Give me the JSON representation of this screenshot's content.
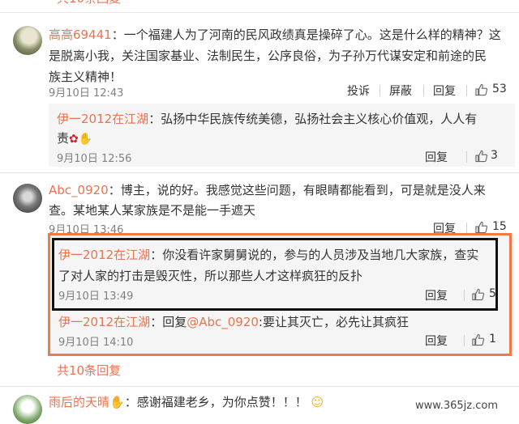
{
  "more_top": "共10条回复",
  "c1": {
    "user": "高高69441",
    "text": "：一个福建人为了河南的民风政绩真是操碎了心。这是什么样的精神？这是脱离小我，关注国家基业、法制民生，公序良俗，为子孙万代谋安定和前途的民族主义精神！",
    "line1": "：一个福建人为了河南的民风政绩真是操碎了心。这是什么样的精神？这",
    "line2": "是脱离小我，关注国家基业、法制民生，公序良俗，为子孙万代谋安定和前途的民",
    "line3": "族主义精神！",
    "time": "9月10日 12:43",
    "report": "投诉",
    "block": "屏蔽",
    "reply": "回复",
    "likes": "53"
  },
  "c1r1": {
    "user": "伊一2012在江湖",
    "line1": "：弘扬中华民族传统美德，弘扬社会主义核心价值观，人人有",
    "line2": "责",
    "time": "9月10日 12:56",
    "reply": "回复",
    "likes": "3"
  },
  "c2": {
    "user": "Abc_0920",
    "line1": "：博主，说的好。我感觉这些问题，有眼睛都能看到，可是就是没人来",
    "line2": "查。某地某人某家族是不是能一手遮天",
    "time": "9月10日 13:46",
    "reply": "回复",
    "likes": "15"
  },
  "c2r1": {
    "user": "伊一2012在江湖",
    "line1": "：你没看许家舅舅说的，参与的人员涉及当地几大家族，查实",
    "line2": "了对人家的打击是毁灭性，所以那些人才这样疯狂的反扑",
    "time": "9月10日 13:49",
    "reply": "回复",
    "likes": "5"
  },
  "c2r2": {
    "user": "伊一2012在江湖",
    "prefix": "：回复",
    "mention": "@Abc_0920",
    "rest": ":要让其灭亡，必先让其疯狂",
    "time": "9月10日 14:10",
    "reply": "回复",
    "likes": "1"
  },
  "more_bottom": "共10条回复",
  "c3": {
    "user": "雨后的天晴",
    "text": "：感谢福建老乡，为你点赞！！！"
  },
  "watermark": "www.365jz.com",
  "colors": {
    "name": "#eb7350",
    "orange_box": "#f07a44",
    "black_box": "#111111"
  }
}
